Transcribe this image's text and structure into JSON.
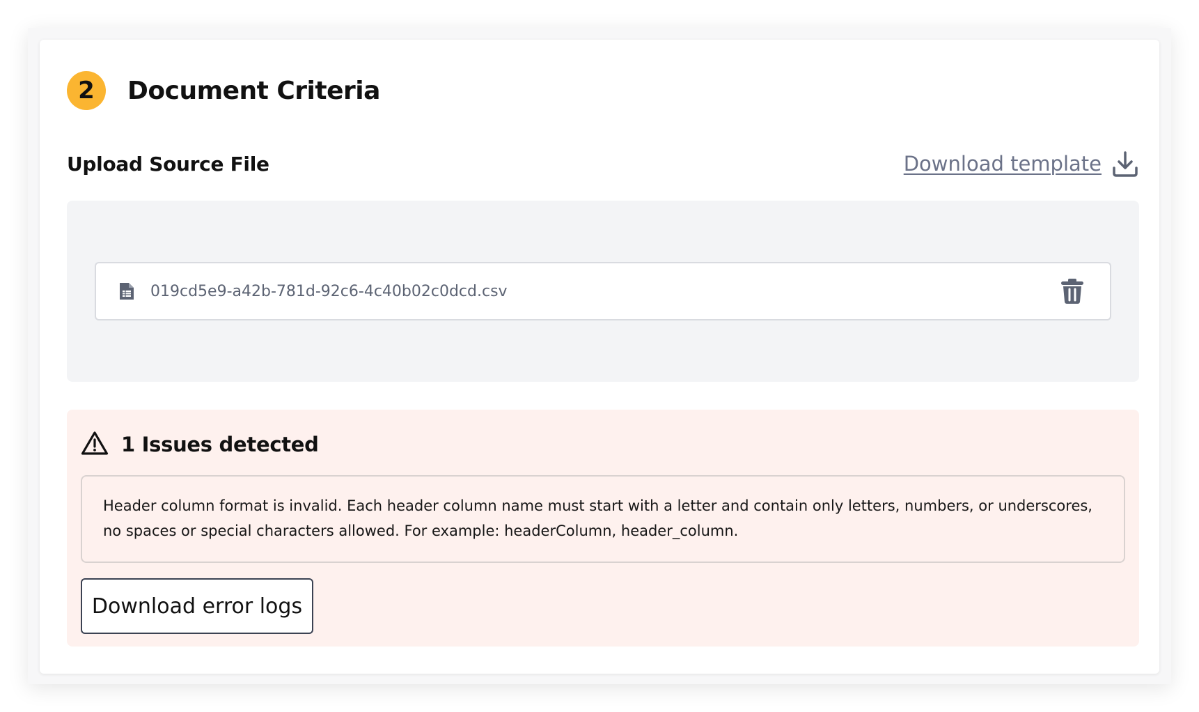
{
  "section": {
    "step_number": "2",
    "title": "Document Criteria"
  },
  "upload": {
    "label": "Upload Source File",
    "download_template_label": "Download template",
    "download_icon": "download-icon"
  },
  "file": {
    "name": "019cd5e9-a42b-781d-92c6-4c40b02c0dcd.csv",
    "file_icon": "spreadsheet-file-icon",
    "delete_icon": "trash-icon"
  },
  "issues": {
    "title": "1 Issues detected",
    "warning_icon": "warning-triangle-icon",
    "message": "Header column format is invalid. Each header column name must start with a letter and contain only letters, numbers, or underscores, no spaces or special characters allowed. For example: headerColumn, header_column.",
    "download_logs_label": "Download error logs"
  },
  "colors": {
    "badge": "#fbb531",
    "link": "#6b7288",
    "dropzone_bg": "#f3f4f6",
    "issues_bg": "#fef1ee",
    "icon_gray": "#5c6373"
  }
}
